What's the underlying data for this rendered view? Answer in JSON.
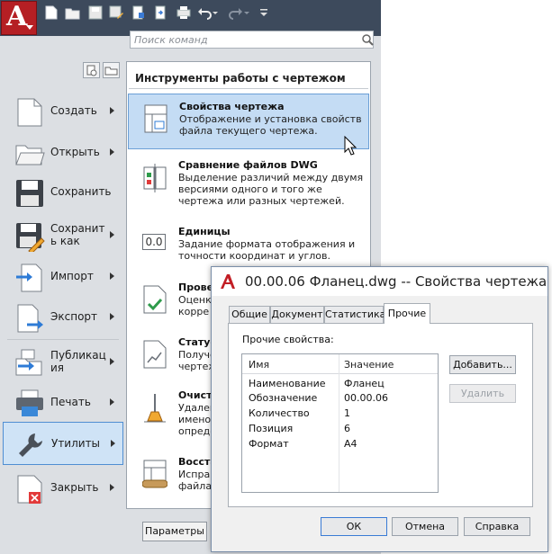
{
  "app": {
    "logo_letter": "A"
  },
  "search": {
    "placeholder": "Поиск команд"
  },
  "menu": {
    "items": [
      {
        "id": "create",
        "label": "Создать",
        "arrow": true
      },
      {
        "id": "open",
        "label": "Открыть",
        "arrow": true
      },
      {
        "id": "save",
        "label": "Сохранить",
        "arrow": false
      },
      {
        "id": "saveas",
        "label": "Сохранить как",
        "label_lines": [
          "Сохранит",
          "ь как"
        ],
        "arrow": true
      },
      {
        "id": "import",
        "label": "Импорт",
        "arrow": true
      },
      {
        "id": "export",
        "label": "Экспорт",
        "arrow": true
      },
      {
        "id": "publish",
        "label": "Публикация",
        "label_lines": [
          "Публикац",
          "ия"
        ],
        "arrow": true
      },
      {
        "id": "print",
        "label": "Печать",
        "arrow": true
      },
      {
        "id": "utilities",
        "label": "Утилиты",
        "arrow": true,
        "selected": true
      },
      {
        "id": "close",
        "label": "Закрыть",
        "arrow": true
      }
    ]
  },
  "submenu": {
    "title": "Инструменты работы с чертежом",
    "items": [
      {
        "title": "Свойства чертежа",
        "desc": "Отображение и установка свойств файла текущего чертежа.",
        "selected": true
      },
      {
        "title": "Сравнение файлов DWG",
        "desc": "Выделение различий между двумя версиями одного и того же чертежа или разных чертежей."
      },
      {
        "title": "Единицы",
        "desc": "Задание формата отображения и точности координат и углов.",
        "icon_text": "0.0"
      },
      {
        "title": "Провер",
        "desc": "Оценк корре"
      },
      {
        "title": "Статус",
        "desc": "Получе чертеж"
      },
      {
        "title": "Очисти",
        "desc": "Удален имено опреде"
      },
      {
        "title": "Восста",
        "desc": "Исправ файла"
      }
    ],
    "params_button": "Параметры"
  },
  "dialog": {
    "title": "00.00.06 Фланец.dwg -- Свойства чертежа",
    "tabs": [
      {
        "label": "Общие",
        "active": false
      },
      {
        "label": "Документ",
        "active": false
      },
      {
        "label": "Статистика",
        "active": false
      },
      {
        "label": "Прочие",
        "active": true
      }
    ],
    "section_label": "Прочие свойства:",
    "columns": [
      "Имя",
      "Значение"
    ],
    "rows": [
      {
        "name": "Наименование",
        "value": "Фланец"
      },
      {
        "name": "Обозначение",
        "value": "00.00.06"
      },
      {
        "name": "Количество",
        "value": "1"
      },
      {
        "name": "Позиция",
        "value": "6"
      },
      {
        "name": "Формат",
        "value": "А4"
      }
    ],
    "add_button": "Добавить...",
    "delete_button": "Удалить",
    "ok_button": "ОК",
    "cancel_button": "Отмена",
    "help_button": "Справка"
  },
  "colors": {
    "accent": "#4f8ed2",
    "logo_red": "#b51f24",
    "topbar": "#3d4a5c"
  }
}
